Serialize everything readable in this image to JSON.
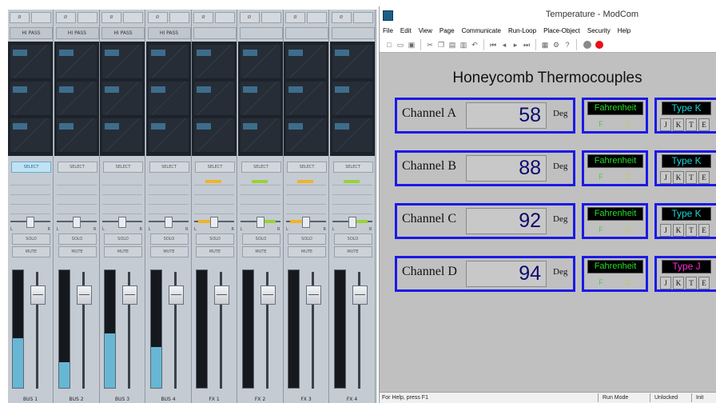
{
  "mixer": {
    "strips": [
      {
        "pass": "HI PASS",
        "select": "SELECT",
        "select_active": true,
        "solo": "SOLO",
        "mute": "MUTE",
        "send_color": "",
        "pan_fill": "",
        "meter": 0.42,
        "fader": 0.1,
        "bottom": "BUS 1"
      },
      {
        "pass": "HI PASS",
        "select": "SELECT",
        "select_active": false,
        "solo": "SOLO",
        "mute": "MUTE",
        "send_color": "",
        "pan_fill": "",
        "meter": 0.22,
        "fader": 0.1,
        "bottom": "BUS 2"
      },
      {
        "pass": "HI PASS",
        "select": "SELECT",
        "select_active": false,
        "solo": "SOLO",
        "mute": "MUTE",
        "send_color": "",
        "pan_fill": "",
        "meter": 0.46,
        "fader": 0.1,
        "bottom": "BUS 3"
      },
      {
        "pass": "HI PASS",
        "select": "SELECT",
        "select_active": false,
        "solo": "SOLO",
        "mute": "MUTE",
        "send_color": "",
        "pan_fill": "",
        "meter": 0.35,
        "fader": 0.1,
        "bottom": "BUS 4"
      },
      {
        "pass": "",
        "select": "SELECT",
        "select_active": false,
        "solo": "SOLO",
        "mute": "MUTE",
        "send_color": "#f0b429",
        "pan_fill": "#f0b429",
        "meter": 0.0,
        "fader": 0.1,
        "bottom": "FX 1"
      },
      {
        "pass": "",
        "select": "SELECT",
        "select_active": false,
        "solo": "SOLO",
        "mute": "MUTE",
        "send_color": "#9bd13a",
        "pan_fill": "#9bd13a",
        "meter": 0.0,
        "fader": 0.1,
        "bottom": "FX 2"
      },
      {
        "pass": "",
        "select": "SELECT",
        "select_active": false,
        "solo": "SOLO",
        "mute": "MUTE",
        "send_color": "#f0b429",
        "pan_fill": "#f0b429",
        "meter": 0.0,
        "fader": 0.1,
        "bottom": "FX 3"
      },
      {
        "pass": "",
        "select": "SELECT",
        "select_active": false,
        "solo": "SOLO",
        "mute": "MUTE",
        "send_color": "#9bd13a",
        "pan_fill": "#9bd13a",
        "meter": 0.0,
        "fader": 0.1,
        "bottom": "FX 4"
      }
    ]
  },
  "window": {
    "title": "Temperature - ModCom",
    "menus": [
      "File",
      "Edit",
      "View",
      "Page",
      "Communicate",
      "Run-Loop",
      "Place-Object",
      "Security",
      "Help"
    ]
  },
  "page": {
    "title": "Honeycomb Thermocouples",
    "channels": [
      {
        "label": "Channel A",
        "value": "58",
        "unit": "Deg",
        "scale": "Fahrenheit",
        "type": "Type K",
        "type_color": "#19d6d6"
      },
      {
        "label": "Channel B",
        "value": "88",
        "unit": "Deg",
        "scale": "Fahrenheit",
        "type": "Type K",
        "type_color": "#19d6d6"
      },
      {
        "label": "Channel C",
        "value": "92",
        "unit": "Deg",
        "scale": "Fahrenheit",
        "type": "Type K",
        "type_color": "#19d6d6"
      },
      {
        "label": "Channel D",
        "value": "94",
        "unit": "Deg",
        "scale": "Fahrenheit",
        "type": "Type J",
        "type_color": "#ff2bd6"
      }
    ],
    "type_options": [
      "J",
      "K",
      "T",
      "E"
    ],
    "scale_options": [
      "F",
      "C"
    ]
  },
  "status": {
    "help": "For Help, press F1",
    "mode": "Run Mode",
    "lock": "Unlocked",
    "extra": "Init"
  }
}
